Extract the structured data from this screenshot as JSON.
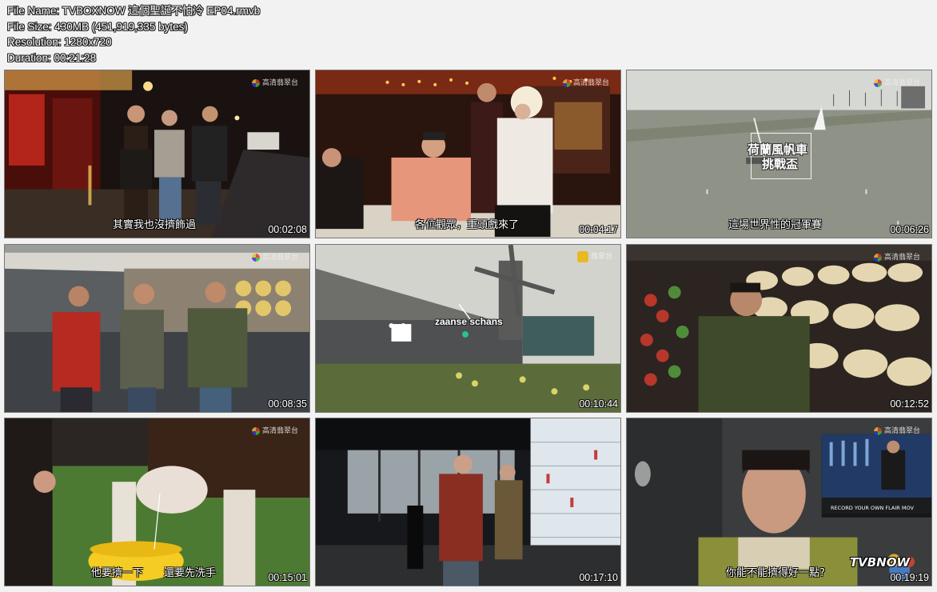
{
  "file_info": {
    "file_name": "File Name: TVBOXNOW 這個聖誕不怕冷 EP04.rmvb",
    "file_size": "File Size: 430MB (451,919,335 bytes)",
    "resolution": "Resolution: 1280x720",
    "duration": "Duration: 00:21:28"
  },
  "thumbnails": [
    {
      "timestamp": "00:02:08",
      "subtitle": "其實我也沒擠飾過",
      "channel_logo": "高清翡翠台",
      "logo_icon": "tvb-logo-icon"
    },
    {
      "timestamp": "00:04:17",
      "subtitle": "各位觀眾，重頭戲來了",
      "channel_logo": "高清翡翠台",
      "logo_icon": "tvb-logo-icon"
    },
    {
      "timestamp": "00:06:26",
      "subtitle": "這場世界性的冠軍賽",
      "channel_logo": "高清翡翠台",
      "logo_icon": "tvb-logo-icon",
      "title_overlay": [
        "荷蘭風帆車",
        "挑戰盃"
      ]
    },
    {
      "timestamp": "00:08:35",
      "subtitle": "",
      "channel_logo": "高清翡翠台",
      "logo_icon": "tvb-logo-icon"
    },
    {
      "timestamp": "00:10:44",
      "subtitle": "",
      "channel_logo": "翡翠台",
      "logo_icon": "tvb-pearl-logo-icon",
      "place_label": "zaanse schans"
    },
    {
      "timestamp": "00:12:52",
      "subtitle": "",
      "channel_logo": "高清翡翠台",
      "logo_icon": "tvb-logo-icon"
    },
    {
      "timestamp": "00:15:01",
      "subtitle": "他要擠一下　　還要先洗手",
      "channel_logo": "高清翡翠台",
      "logo_icon": "tvb-logo-icon"
    },
    {
      "timestamp": "00:17:10",
      "subtitle": "",
      "channel_logo": "",
      "logo_icon": ""
    },
    {
      "timestamp": "00:19:19",
      "subtitle": "你能不能擠得好一點?",
      "channel_logo": "高清翡翠台",
      "logo_icon": "tvb-logo-icon",
      "screen_text": "RECORD YOUR OWN FLAIR MOV",
      "watermark": "TVBNOW"
    }
  ],
  "colors": {
    "page_background": "#f2f2f2",
    "text_fill": "#ffffff",
    "text_outline": "#222222"
  }
}
